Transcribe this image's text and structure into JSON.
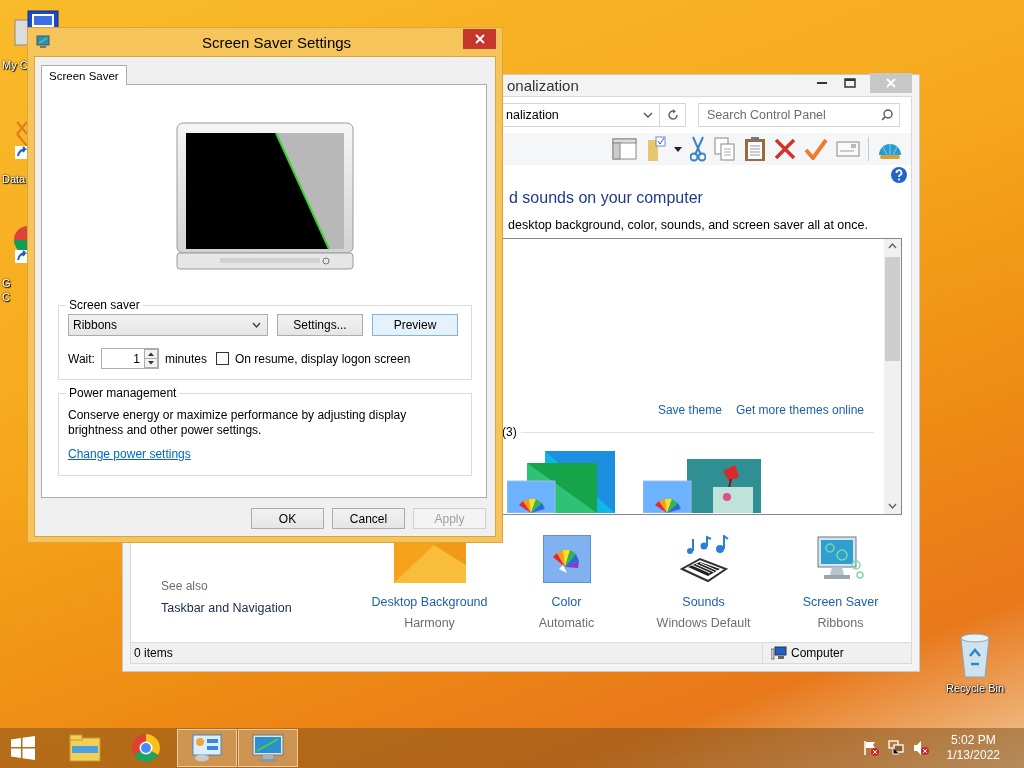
{
  "desktop_icons": [
    {
      "kind": "computer",
      "lines": [
        "My C"
      ]
    },
    {
      "kind": "file",
      "lines": [
        "Data"
      ]
    },
    {
      "kind": "app",
      "lines": [
        "G",
        "C"
      ]
    }
  ],
  "recycle_bin": {
    "label": "Recycle Bin"
  },
  "control_panel": {
    "title": "onalization",
    "address": "nalization",
    "search_placeholder": "Search Control Panel",
    "heading": "d sounds on your computer",
    "subtitle": "desktop background, color, sounds, and screen saver all at once.",
    "theme_links": [
      "Save theme",
      "Get more themes online"
    ],
    "group_count": "(3)",
    "see_also": {
      "title": "See also",
      "links": [
        "Taskbar and Navigation"
      ]
    },
    "settings": [
      {
        "kind": "background",
        "title": "Desktop Background",
        "value": "Harmony"
      },
      {
        "kind": "color",
        "title": "Color",
        "value": "Automatic"
      },
      {
        "kind": "sounds",
        "title": "Sounds",
        "value": "Windows Default"
      },
      {
        "kind": "screensaver",
        "title": "Screen Saver",
        "value": "Ribbons"
      }
    ],
    "status_bar": {
      "items": "0 items",
      "location": "Computer"
    }
  },
  "dialog": {
    "title": "Screen Saver Settings",
    "tabs": [
      {
        "label": "Screen Saver",
        "selected": true
      }
    ],
    "screen_saver": {
      "legend": "Screen saver",
      "value": "Ribbons",
      "buttons": [
        {
          "label": "Settings...",
          "default": false
        },
        {
          "label": "Preview",
          "default": true
        }
      ],
      "wait_label": "Wait:",
      "wait_value": "1",
      "wait_unit": "minutes",
      "logon": {
        "label": "On resume, display logon screen",
        "checked": false
      }
    },
    "power": {
      "legend": "Power management",
      "text": "Conserve energy or maximize performance by adjusting display brightness and other power settings.",
      "link": "Change power settings"
    },
    "buttons": [
      {
        "label": "OK",
        "disabled": false
      },
      {
        "label": "Cancel",
        "disabled": false
      },
      {
        "label": "Apply",
        "disabled": true
      }
    ]
  },
  "taskbar": {
    "items": [
      {
        "kind": "explorer",
        "active": false
      },
      {
        "kind": "browser",
        "active": false
      },
      {
        "kind": "control_panel",
        "active": true
      },
      {
        "kind": "screensaver",
        "active": true
      }
    ],
    "time": "5:02 PM",
    "date": "1/13/2022"
  }
}
